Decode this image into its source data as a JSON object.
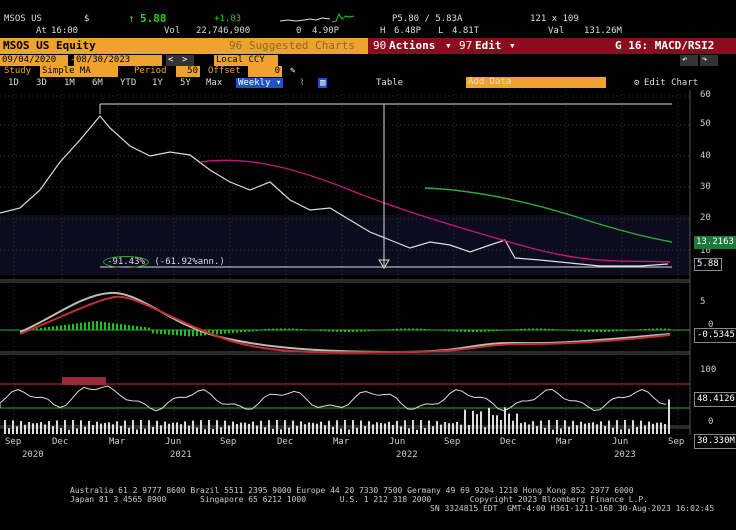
{
  "ticker": {
    "symbol": "MSOS US",
    "currency_symbol": "$",
    "last_price": "5.88",
    "change": "+1.03",
    "at_label": "At",
    "at_time": "16:00",
    "vol_label": "Vol",
    "volume": "22,746,900",
    "open_label": "0",
    "open_value": "4.90P",
    "high_label": "H",
    "high_value": "6.48P",
    "low_label": "L",
    "low_value": "4.81T",
    "bid_ask": "P5.80 / 5.83A",
    "size": "121 x 109",
    "val_label": "Val",
    "val_value": "131.26M"
  },
  "title_bar": {
    "security": "MSOS US Equity",
    "suggested": "96 Suggested Charts",
    "actions": "Actions",
    "actions_num": "90",
    "edit": "Edit",
    "edit_num": "97",
    "function": "G 16: MACD/RSI2"
  },
  "controls": {
    "start_date": "09/04/2020",
    "end_date": "08/30/2023",
    "currency": "Local CCY",
    "study_label": "Study",
    "study_value": "Simple MA",
    "period_label": "Period",
    "period_value": "50",
    "offset_label": "Offset",
    "offset_value": "0"
  },
  "ranges": {
    "items": [
      "1D",
      "3D",
      "1M",
      "6M",
      "YTD",
      "1Y",
      "5Y",
      "Max"
    ],
    "frequency": "Weekly",
    "table_label": "Table",
    "add_data": "Add Data",
    "edit_chart": "Edit Chart"
  },
  "price_panel": {
    "axis_ticks": [
      "60",
      "50",
      "40",
      "30",
      "20",
      "10"
    ],
    "last_tag": "5.88",
    "ma_tag": "13.2163",
    "annotation_pct": "-91.43%",
    "annotation_ann": "(-61.92%ann.)"
  },
  "macd_panel": {
    "axis_ticks": [
      "5",
      "0"
    ],
    "tag": "-0.5345"
  },
  "rsi_panel": {
    "axis_ticks": [
      "100",
      "0"
    ],
    "tag": "48.4126"
  },
  "volume_panel": {
    "tag": "30.330M"
  },
  "x_axis": {
    "months": [
      "Sep",
      "Dec",
      "Mar",
      "Jun",
      "Sep",
      "Dec",
      "Mar",
      "Jun",
      "Sep",
      "Dec",
      "Mar",
      "Jun",
      "Sep"
    ],
    "years": [
      "2020",
      "2021",
      "2022",
      "2023"
    ]
  },
  "footer": {
    "line1": "Australia 61 2 9777 8600 Brazil 5511 2395 9000 Europe 44 20 7330 7500 Germany 49 69 9204 1210 Hong Kong 852 2977 6000",
    "line2": "Japan 81 3 4565 8900       Singapore 65 6212 1000       U.S. 1 212 318 2000        Copyright 2023 Bloomberg Finance L.P.",
    "line3": "SN 3324815 EDT  GMT-4:00 H361-1211-168 30-Aug-2023 16:02:45"
  },
  "colors": {
    "accent": "#f0a22e",
    "red_bar": "#8a0d1e",
    "ma_line": "#c0187a",
    "ma_long": "#2fa83a",
    "histogram": "#22c022"
  }
}
